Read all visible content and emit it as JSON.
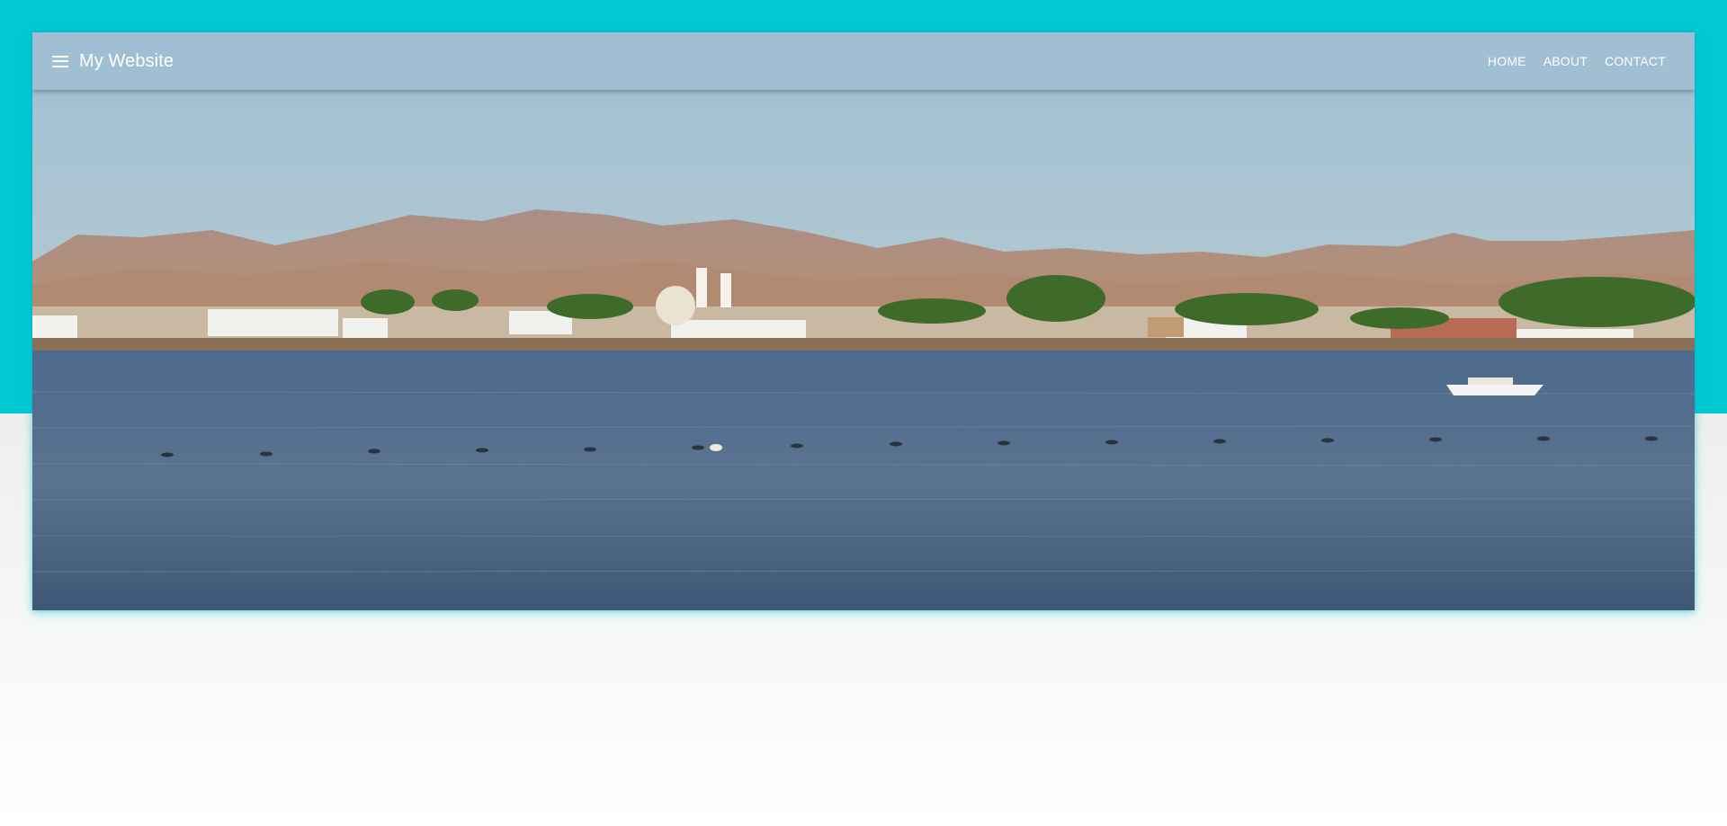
{
  "header": {
    "title": "My Website",
    "menu_icon": "hamburger-menu-icon"
  },
  "nav": {
    "items": [
      {
        "label": "HOME"
      },
      {
        "label": "ABOUT"
      },
      {
        "label": "CONTACT"
      }
    ]
  },
  "theme": {
    "accent": "#00c8d4",
    "text": "#ffffff"
  }
}
